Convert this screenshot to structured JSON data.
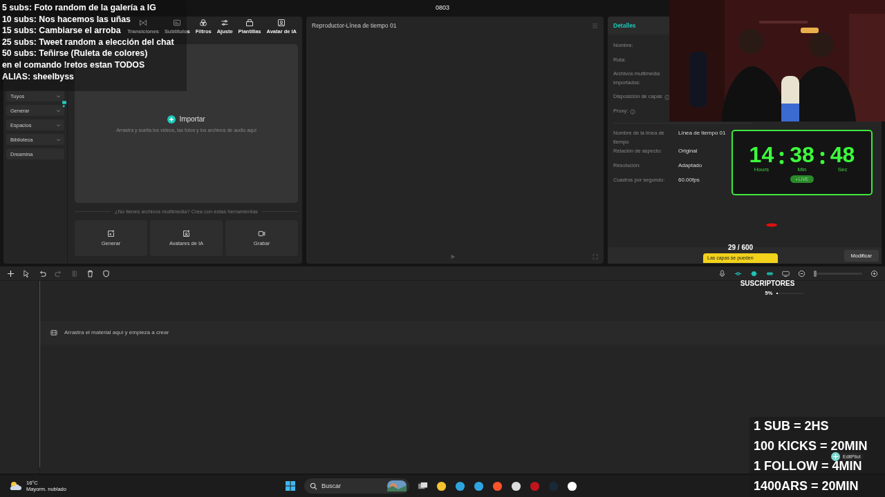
{
  "window": {
    "title": "0803"
  },
  "media_panel": {
    "tabs": [
      {
        "label": "Transiciones"
      },
      {
        "label": "Subtítulos"
      },
      {
        "label": "Filtros"
      },
      {
        "label": "Ajuste"
      },
      {
        "label": "Plantillas"
      },
      {
        "label": "Avatar de IA"
      }
    ],
    "sidebar": [
      {
        "label": "Tuyos",
        "kind": "dropdown",
        "new": false
      },
      {
        "label": "Generar",
        "kind": "dropdown",
        "new": true
      },
      {
        "label": "Espacios",
        "kind": "dropdown",
        "new": false
      },
      {
        "label": "Biblioteca",
        "kind": "dropdown",
        "new": false
      },
      {
        "label": "Dreamina",
        "kind": "link",
        "new": false
      }
    ],
    "import": {
      "label": "Importar",
      "hint": "Arrastra y suelta los videos, las fotos y los archivos de audio aquí"
    },
    "divider_text": "¿No tienes archivos multimedia? Crea con estas herramientas",
    "tools": [
      {
        "label": "Generar"
      },
      {
        "label": "Avatares de IA"
      },
      {
        "label": "Grabar"
      }
    ]
  },
  "player": {
    "title": "Reproductor-Línea de tiempo 01"
  },
  "details": {
    "title": "Detalles",
    "fields": [
      {
        "label": "Nombre:",
        "info": false
      },
      {
        "label": "Ruta:",
        "info": false
      },
      {
        "label": "Archivos multimedia importados:",
        "info": false
      },
      {
        "label": "Disposición de capas",
        "info": true
      },
      {
        "label": "Proxy:",
        "info": true
      }
    ],
    "timeline_fields": [
      {
        "label": "Nombre de la línea de tiempo",
        "value": "Línea de tiempo 01"
      },
      {
        "label": "Relación de aspecto:",
        "value": "Original"
      },
      {
        "label": "Resolución:",
        "value": "Adaptado"
      },
      {
        "label": "Cuadros por segundo:",
        "value": "60.00fps"
      }
    ],
    "button": "Modificar"
  },
  "timeline": {
    "zoom": {
      "level": 0.0
    },
    "empty_hint": "Arrastra el material aquí y empieza a crear"
  },
  "taskbar": {
    "weather": {
      "temperature": "16°C",
      "condition": "Mayorm. nublado"
    },
    "search": {
      "placeholder": "Buscar"
    }
  },
  "stream_overlay": {
    "goals": [
      "5 subs: Foto random de la galería a IG",
      "10 subs: Nos hacemos las uñas",
      "15 subs: Cambiarse el arroba",
      "25 subs: Tweet random a elección del chat",
      "50 subs: Teñirse (Ruleta de colores)",
      "en el comando !retos estan TODOS",
      "ALIAS: sheelbyss"
    ],
    "timer": {
      "units": [
        {
          "value": "14",
          "label": "Hours"
        },
        {
          "value": "38",
          "label": "Min"
        },
        {
          "value": "48",
          "label": "Sec"
        }
      ],
      "live": "• LIVE"
    },
    "sub_goal": {
      "count": "29 / 600",
      "label": "SUSCRIPTORES",
      "percent": "5%",
      "level": 0.05
    },
    "tooltip": "Las capas se pueden",
    "rates": [
      "1 SUB = 2HS",
      "100 KICKS = 20MIN",
      "1 FOLLOW = 4MIN",
      "1400ARS = 20MIN"
    ],
    "badge": "EditPilot"
  }
}
